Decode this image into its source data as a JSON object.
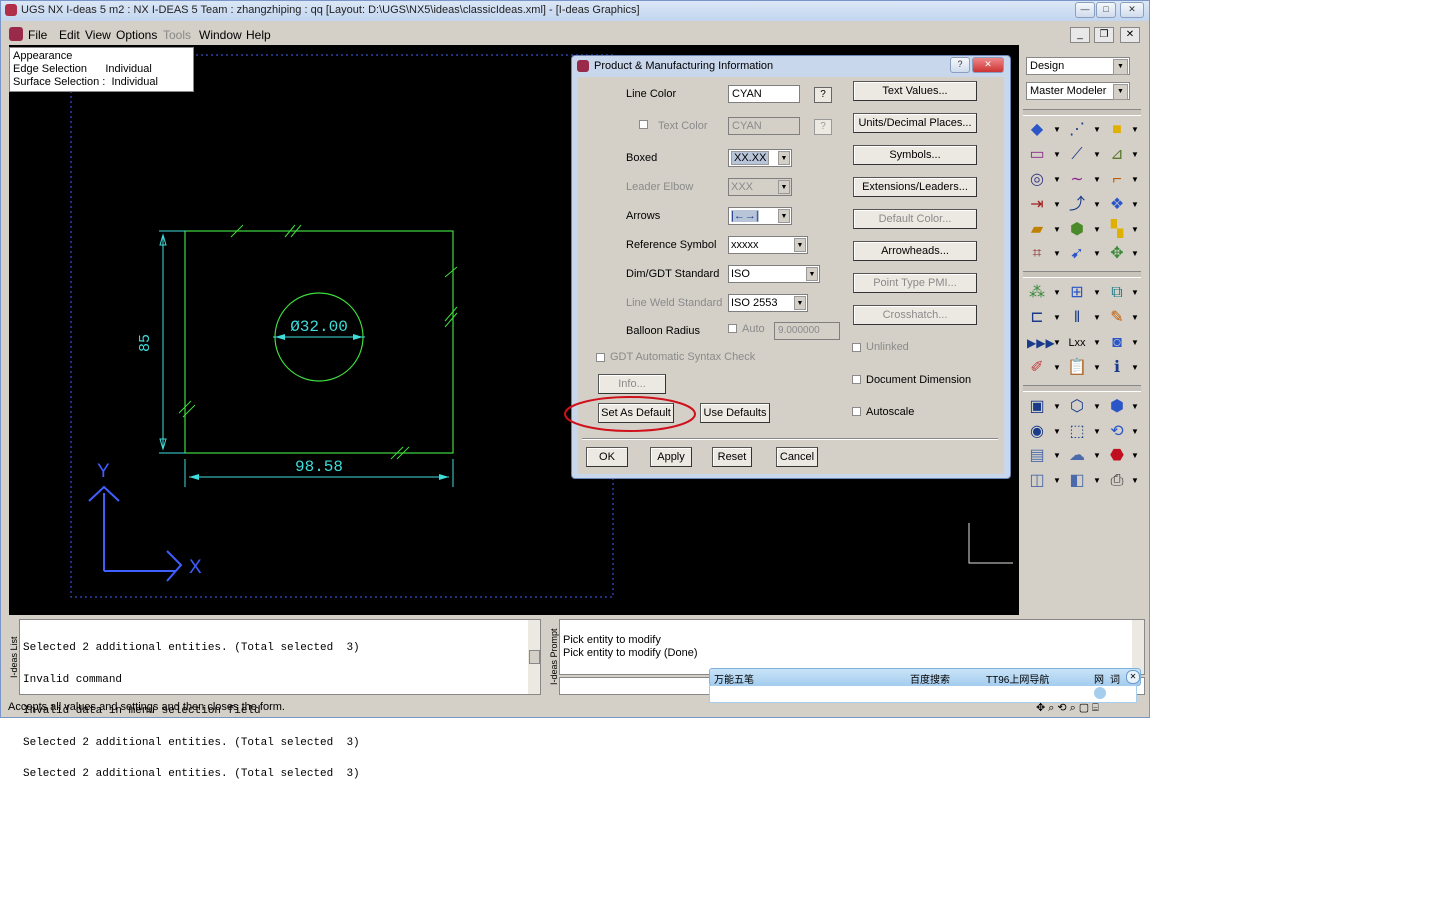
{
  "window": {
    "title": "UGS NX I-deas 5 m2 :     NX I-DEAS 5 Team : zhangzhiping : qq   [Layout: D:\\UGS\\NX5\\ideas\\classicIdeas.xml]   - [I-deas Graphics]"
  },
  "menubar": {
    "items": [
      "File",
      "Edit",
      "View",
      "Options",
      "Tools",
      "Window",
      "Help"
    ]
  },
  "infobox": {
    "line1": "Appearance",
    "line2_label": "Edge Selection",
    "line2_value": "Individual",
    "line3_label": "Surface Selection :",
    "line3_value": "Individual"
  },
  "drawing": {
    "dim_width": "98.58",
    "dim_height": "85",
    "dim_hole": "Ø32.00",
    "axis_y": "Y",
    "axis_x": "X"
  },
  "dialog": {
    "title": "Product & Manufacturing Information",
    "line_color_label": "Line Color",
    "line_color_value": "CYAN",
    "text_color_label": "Text Color",
    "text_color_value": "CYAN",
    "boxed_label": "Boxed",
    "boxed_value": "XX.XX",
    "leader_elbow_label": "Leader Elbow",
    "leader_elbow_value": "XXX",
    "arrows_label": "Arrows",
    "arrows_value": "|←→|",
    "ref_symbol_label": "Reference Symbol",
    "ref_symbol_value": "xxxxx",
    "standard_label": "Dim/GDT Standard",
    "standard_value": "ISO",
    "weld_label": "Line Weld Standard",
    "weld_value": "ISO 2553",
    "balloon_label": "Balloon Radius",
    "auto_label": "Auto",
    "balloon_value": "9.000000",
    "gdt_check_label": "GDT Automatic Syntax Check",
    "info_btn": "Info...",
    "set_default_btn": "Set As Default",
    "use_defaults_btn": "Use Defaults",
    "text_values_btn": "Text Values...",
    "units_btn": "Units/Decimal Places...",
    "symbols_btn": "Symbols...",
    "extensions_btn": "Extensions/Leaders...",
    "default_color_btn": "Default Color...",
    "arrowheads_btn": "Arrowheads...",
    "point_type_btn": "Point Type PMI...",
    "crosshatch_btn": "Crosshatch...",
    "unlinked_label": "Unlinked",
    "document_dim_label": "Document Dimension",
    "autoscale_label": "Autoscale",
    "ok_btn": "OK",
    "apply_btn": "Apply",
    "reset_btn": "Reset",
    "cancel_btn": "Cancel",
    "help_q": "?"
  },
  "right_panel": {
    "task": "Design",
    "application": "Master Modeler"
  },
  "list_pane": {
    "tab": "I-deas List",
    "lines": [
      "Selected 2 additional entities. (Total selected  3)",
      "Invalid command",
      "Invalid data in menu selection field",
      "Selected 2 additional entities. (Total selected  3)",
      "Selected 2 additional entities. (Total selected  3)"
    ]
  },
  "prompt_pane": {
    "tab": "I-deas Prompt",
    "lines": [
      "Pick entity to modify",
      "Pick entity to modify (Done)"
    ]
  },
  "ime_bar": {
    "label1": "万能五笔",
    "label2": "百度搜索",
    "label3": "TT96上网导航",
    "label4": "网",
    "label5": "词"
  },
  "statusbar": {
    "text": "Accepts all values and settings and then closes the form."
  },
  "colors": {
    "drawing_green": "#3fdc3f",
    "drawing_cyan": "#3fdcdc",
    "axis_blue": "#3f5fff",
    "highlight_red": "#d0101a"
  }
}
